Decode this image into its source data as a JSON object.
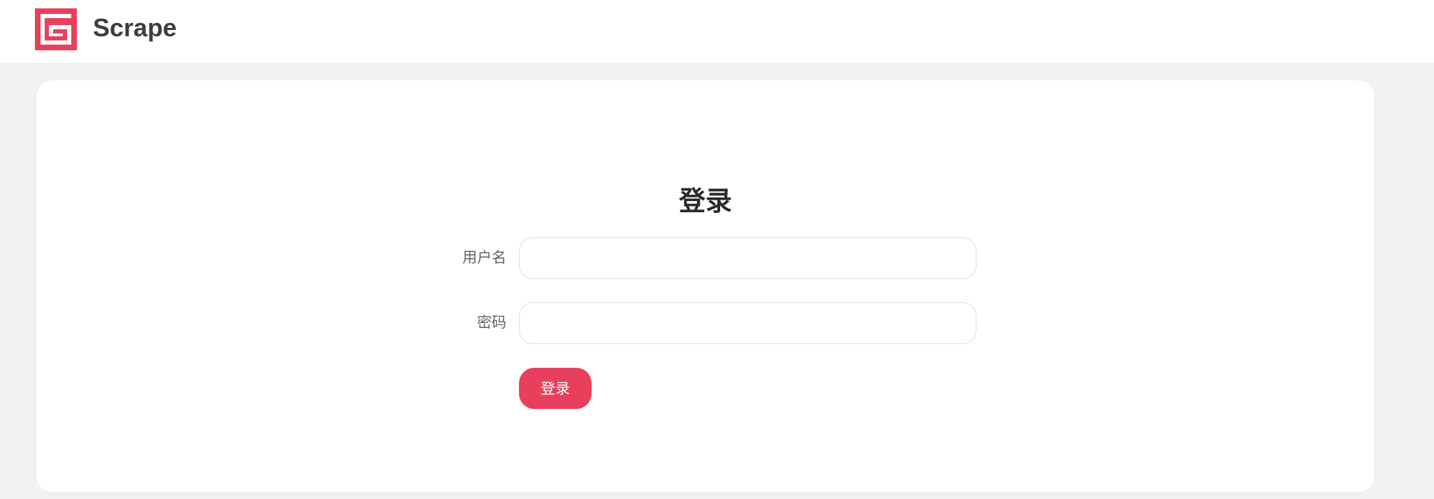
{
  "header": {
    "brand": "Scrape",
    "logo_icon": "scrape-logo-icon",
    "accent_color": "#e8405c"
  },
  "login": {
    "title": "登录",
    "username_label": "用户名",
    "username_value": "",
    "username_placeholder": "",
    "password_label": "密码",
    "password_value": "",
    "password_placeholder": "",
    "submit_label": "登录"
  }
}
